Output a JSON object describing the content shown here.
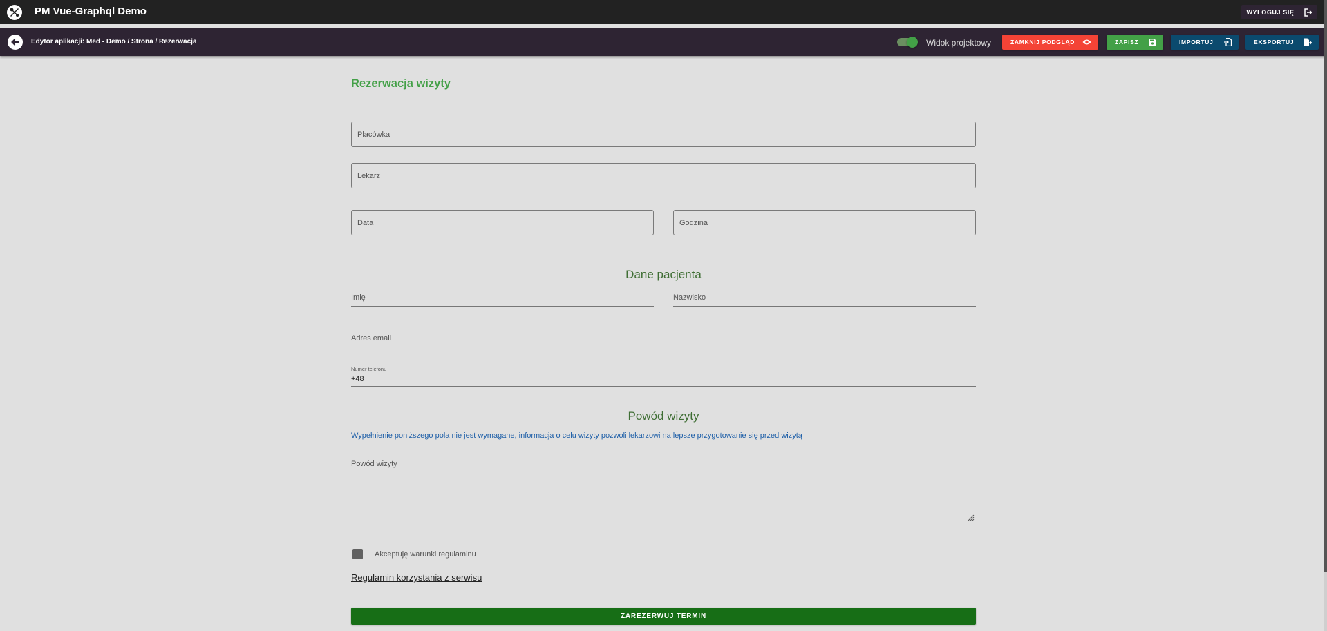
{
  "app": {
    "title": "PM Vue-Graphql Demo",
    "logout_label": "WYLOGUJ SIĘ"
  },
  "editor": {
    "breadcrumb": "Edytor aplikacji: Med - Demo / Strona / Rezerwacja",
    "toggle_label": "Widok projektowy",
    "toggle_on": true,
    "buttons": {
      "close_preview": "ZAMKNIJ PODGLĄD",
      "save": "ZAPISZ",
      "import": "IMPORTUJ",
      "export": "EKSPORTUJ"
    },
    "colors": {
      "close_preview": "#f44336",
      "save": "#43a047",
      "import": "#0b4a6e",
      "export": "#0b4a6e"
    }
  },
  "form": {
    "title": "Rezerwacja wizyty",
    "fields": {
      "facility": "Placówka",
      "doctor": "Lekarz",
      "date": "Data",
      "time": "Godzina"
    },
    "patient": {
      "section_title": "Dane pacjenta",
      "first_name": "Imię",
      "last_name": "Nazwisko",
      "email": "Adres email",
      "phone_label": "Numer telefonu",
      "phone_value": "+48"
    },
    "reason": {
      "section_title": "Powód wizyty",
      "info": "Wypełnienie poniższego pola nie jest wymagane, informacja o celu wizyty pozwoli lekarzowi na lepsze przygotowanie się przed wizytą",
      "placeholder": "Powód wizyty"
    },
    "terms_checkbox_label": "Akceptuję warunki regulaminu",
    "terms_link": "Regulamin korzystania z serwisu",
    "submit_label": "ZAREZERWUJ TERMIN"
  }
}
